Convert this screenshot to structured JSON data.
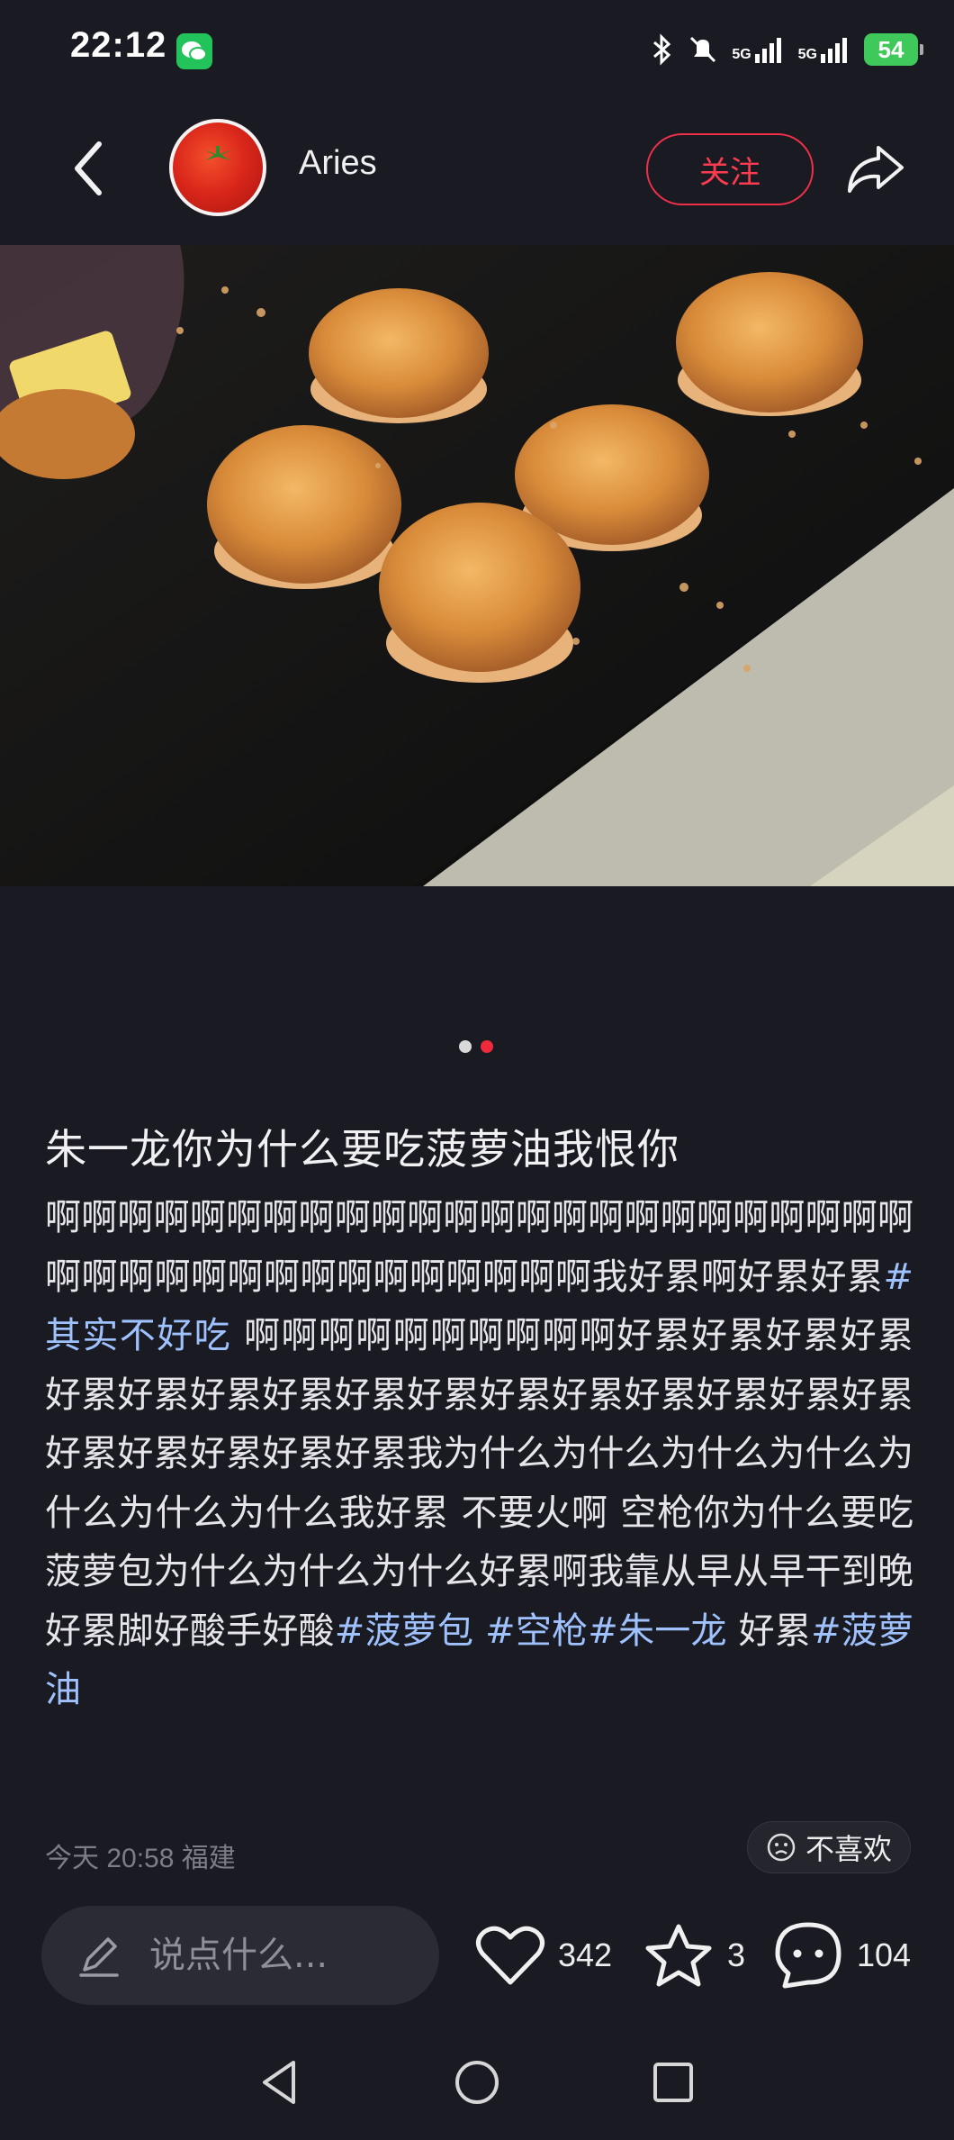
{
  "status_bar": {
    "time": "22:12",
    "network_1": "5G",
    "network_2": "5G",
    "battery": "54",
    "icons": [
      "wechat-icon",
      "bluetooth-icon",
      "mute-bell-icon",
      "signal-icon",
      "signal-icon",
      "battery-charging-icon"
    ]
  },
  "header": {
    "username": "Aries",
    "follow_label": "关注",
    "icons": [
      "back-arrow-icon",
      "tomato-avatar",
      "share-icon"
    ],
    "accent_color": "#f0304a"
  },
  "carousel": {
    "count": 2,
    "active_index": 1
  },
  "post": {
    "title": "朱一龙你为什么要吃菠萝油我恨你",
    "body": {
      "seg1": "啊啊啊啊啊啊啊啊啊啊啊啊啊啊啊啊啊啊啊啊啊啊啊啊啊啊啊啊啊啊啊啊啊啊啊啊啊啊啊我好累啊好累好累",
      "tag1": "#其实不好吃",
      "seg2": " 啊啊啊啊啊啊啊啊啊啊好累好累好累好累好累好累好累好累好累好累好累好累好累好累好累好累好累好累好累好累好累我为什么为什么为什么为什么为什么为什么为什么我好累  不要火啊  空枪你为什么要吃菠萝包为什么为什么为什么好累啊我靠从早从早干到晚好累脚好酸手好酸",
      "tag2": "#菠萝包",
      "tag3": " #空枪",
      "tag4": "#朱一龙",
      "seg3": " 好累",
      "tag5": "#菠萝油"
    },
    "meta": "今天 20:58 福建",
    "dislike_label": "不喜欢"
  },
  "actions": {
    "comment_placeholder": "说点什么...",
    "likes": "342",
    "favorites": "3",
    "comments": "104"
  },
  "system_nav": [
    "back-triangle-icon",
    "home-circle-icon",
    "recents-square-icon"
  ]
}
